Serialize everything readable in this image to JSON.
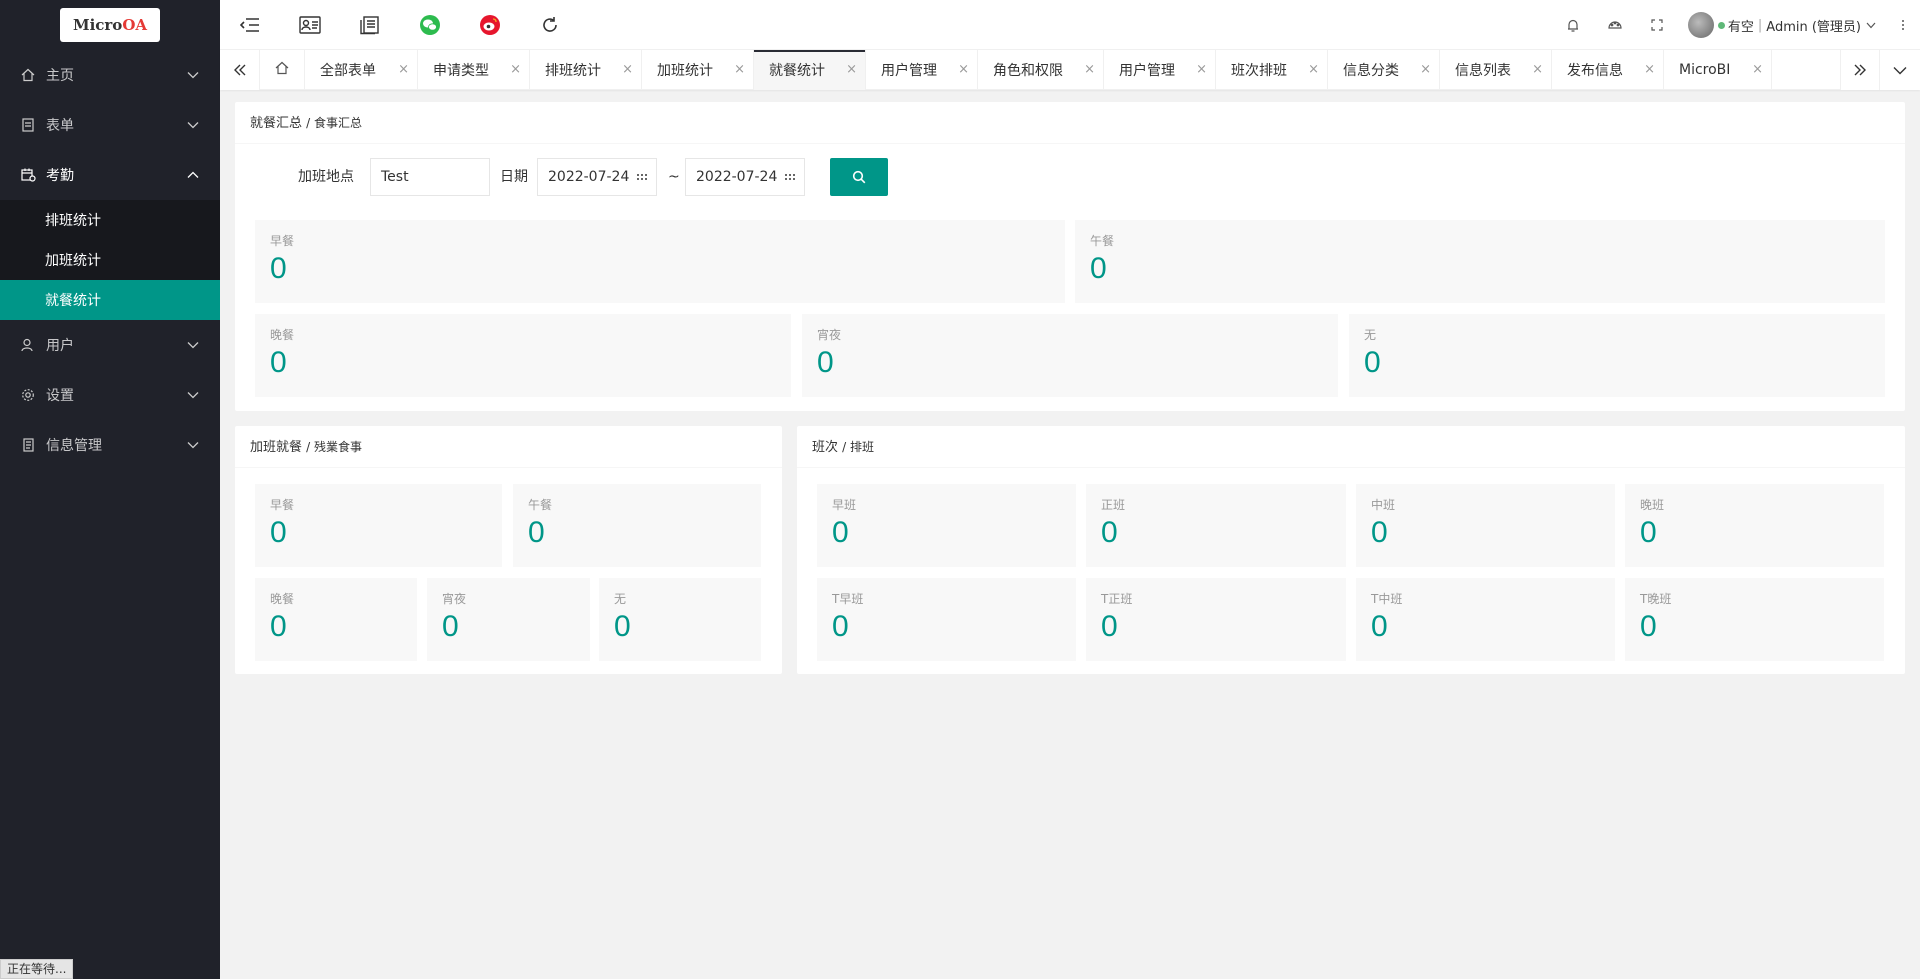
{
  "logo": {
    "text_main": "Micro",
    "text_accent": "OA"
  },
  "sidebar": {
    "items": [
      {
        "label": "主页",
        "icon": "home-icon"
      },
      {
        "label": "表单",
        "icon": "form-icon"
      },
      {
        "label": "考勤",
        "icon": "calendar-icon",
        "open": true,
        "children": [
          {
            "label": "排班统计"
          },
          {
            "label": "加班统计"
          },
          {
            "label": "就餐统计",
            "active": true
          }
        ]
      },
      {
        "label": "用户",
        "icon": "user-icon"
      },
      {
        "label": "设置",
        "icon": "gear-icon"
      },
      {
        "label": "信息管理",
        "icon": "document-icon"
      }
    ]
  },
  "header": {
    "tools": [
      "menu-toggle-icon",
      "contacts-icon",
      "documents-icon",
      "wechat-icon",
      "weibo-icon",
      "refresh-icon"
    ],
    "user": {
      "status": "有空",
      "separator": "|",
      "name": "Admin (管理员)"
    }
  },
  "tabs": [
    {
      "label": "全部表单"
    },
    {
      "label": "申请类型"
    },
    {
      "label": "排班统计"
    },
    {
      "label": "加班统计"
    },
    {
      "label": "就餐统计",
      "active": true
    },
    {
      "label": "用户管理"
    },
    {
      "label": "角色和权限"
    },
    {
      "label": "用户管理"
    },
    {
      "label": "班次排班"
    },
    {
      "label": "信息分类"
    },
    {
      "label": "信息列表"
    },
    {
      "label": "发布信息"
    },
    {
      "label": "MicroBI"
    }
  ],
  "tab_close_glyph": "×",
  "summary": {
    "title": "就餐汇总",
    "subtitle": "/ 食事汇总",
    "form": {
      "location_label": "加班地点",
      "location_value": "Test",
      "date_label": "日期",
      "date_from": "2022-07-24",
      "date_sep": "~",
      "date_to": "2022-07-24"
    },
    "stats_row1": [
      {
        "label": "早餐",
        "value": "0"
      },
      {
        "label": "午餐",
        "value": "0"
      }
    ],
    "stats_row2": [
      {
        "label": "晚餐",
        "value": "0"
      },
      {
        "label": "宵夜",
        "value": "0"
      },
      {
        "label": "无",
        "value": "0"
      }
    ]
  },
  "overtime": {
    "title": "加班就餐",
    "subtitle": "/ 残業食事",
    "stats": [
      {
        "label": "早餐",
        "value": "0"
      },
      {
        "label": "午餐",
        "value": "0"
      },
      {
        "label": "晚餐",
        "value": "0"
      },
      {
        "label": "宵夜",
        "value": "0"
      },
      {
        "label": "无",
        "value": "0"
      }
    ]
  },
  "shifts": {
    "title": "班次",
    "subtitle": "/ 排班",
    "stats": [
      {
        "label": "早班",
        "value": "0"
      },
      {
        "label": "正班",
        "value": "0"
      },
      {
        "label": "中班",
        "value": "0"
      },
      {
        "label": "晚班",
        "value": "0"
      },
      {
        "label": "T早班",
        "value": "0"
      },
      {
        "label": "T正班",
        "value": "0"
      },
      {
        "label": "T中班",
        "value": "0"
      },
      {
        "label": "T晚班",
        "value": "0"
      }
    ]
  },
  "status_bar": "正在等待...",
  "colors": {
    "accent": "#009688",
    "sidebar_bg": "#20222a",
    "submenu_bg": "#17181d"
  }
}
